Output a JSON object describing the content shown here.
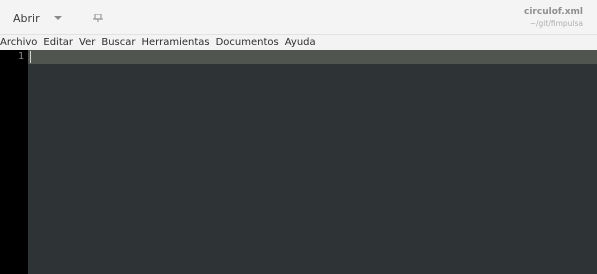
{
  "header": {
    "open_label": "Abrir",
    "open_menu_icon": "chevron-down-icon",
    "pin_icon": "pin-icon",
    "document_title": "circulof.xml",
    "document_path": "~/git/fimpulsa"
  },
  "menubar": {
    "items": [
      "Archivo",
      "Editar",
      "Ver",
      "Buscar",
      "Herramientas",
      "Documentos",
      "Ayuda"
    ]
  },
  "editor": {
    "line_numbers": [
      "1"
    ],
    "content": "",
    "colors": {
      "background": "#2e3436",
      "gutter": "#000000",
      "current_line": "#50554f"
    }
  }
}
